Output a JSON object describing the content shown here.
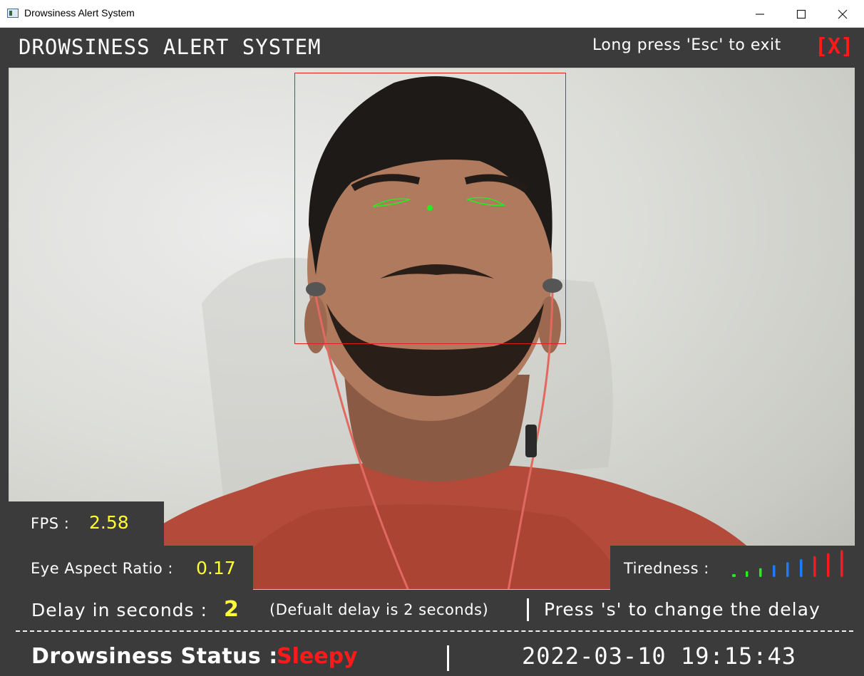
{
  "window": {
    "title": "Drowsiness Alert System",
    "icon": "app-window-icon",
    "controls": [
      "minimize-icon",
      "maximize-icon",
      "close-icon"
    ]
  },
  "header": {
    "title": "DROWSINESS ALERT SYSTEM",
    "exit_hint": "Long press 'Esc' to exit",
    "exit_button": "[X]"
  },
  "stats": {
    "fps_label": "FPS :",
    "fps_value": "2.58",
    "ear_label": "Eye Aspect Ratio :",
    "ear_value": "0.17",
    "tiredness_label": "Tiredness :",
    "tiredness_bars": [
      {
        "color": "#22ee22"
      },
      {
        "color": "#22ee22"
      },
      {
        "color": "#22ee22"
      },
      {
        "color": "#1e7bff"
      },
      {
        "color": "#1e7bff"
      },
      {
        "color": "#1e7bff"
      },
      {
        "color": "#ff1a1a"
      },
      {
        "color": "#ff1a1a"
      },
      {
        "color": "#ff1a1a"
      }
    ]
  },
  "delay": {
    "label": "Delay in seconds :",
    "value": "2",
    "default_note": "(Defualt delay is 2 seconds)",
    "instruction": "Press 's' to change the delay"
  },
  "status": {
    "label": "Drowsiness Status :",
    "value": "Sleepy",
    "datetime": "2022-03-10 19:15:43"
  },
  "colors": {
    "background": "#3b3b3b",
    "value_yellow": "#ffff33",
    "alert_red": "#ff1a1a",
    "face_box": "#e02020",
    "eye_outline": "#22ee22"
  }
}
